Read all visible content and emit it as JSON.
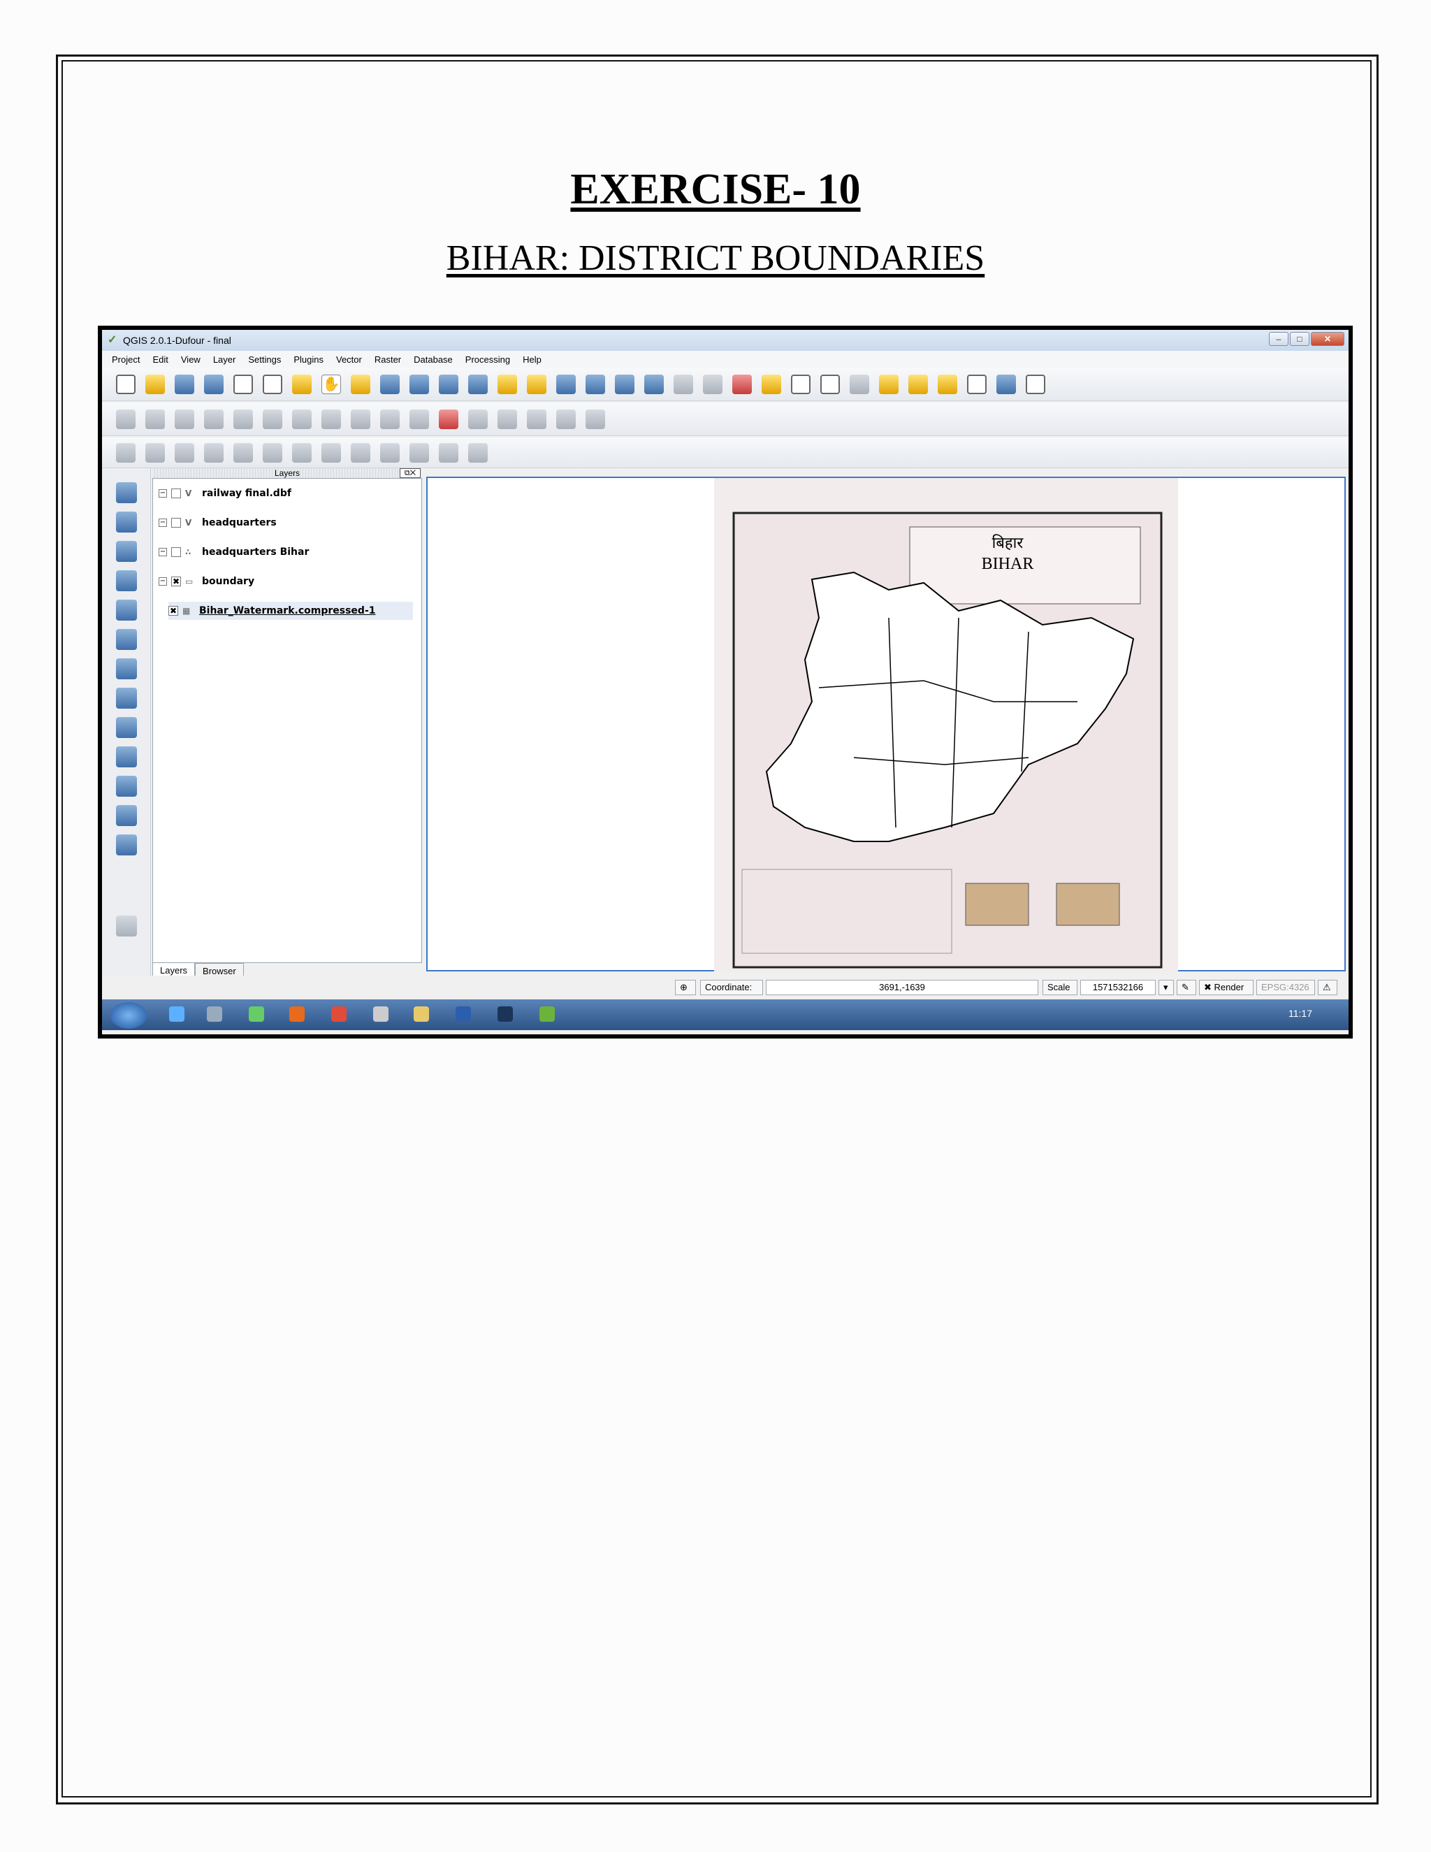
{
  "page": {
    "heading": "EXERCISE- 10",
    "subheading": "BIHAR: DISTRICT BOUNDARIES"
  },
  "qgis": {
    "window_title": "QGIS 2.0.1-Dufour - final",
    "menu": [
      "Project",
      "Edit",
      "View",
      "Layer",
      "Settings",
      "Plugins",
      "Vector",
      "Raster",
      "Database",
      "Processing",
      "Help"
    ],
    "layers_panel_title": "Layers",
    "layers": [
      {
        "name": "railway final.dbf",
        "checked": false
      },
      {
        "name": "headquarters",
        "checked": false
      },
      {
        "name": "headquarters Bihar",
        "checked": false
      },
      {
        "name": "boundary",
        "checked": true
      },
      {
        "name": "Bihar_Watermark.compressed-1",
        "checked": true
      }
    ],
    "tabs": [
      "Layers",
      "Browser"
    ],
    "map_label_hindi": "बिहार",
    "map_label": "BIHAR",
    "status": {
      "coordinate_label": "Coordinate:",
      "coordinate_value": "3691,-1639",
      "scale_label": "Scale",
      "scale_value": "1571532166",
      "render_label": "Render",
      "crs": "EPSG:4326"
    },
    "clock": "11:17"
  }
}
